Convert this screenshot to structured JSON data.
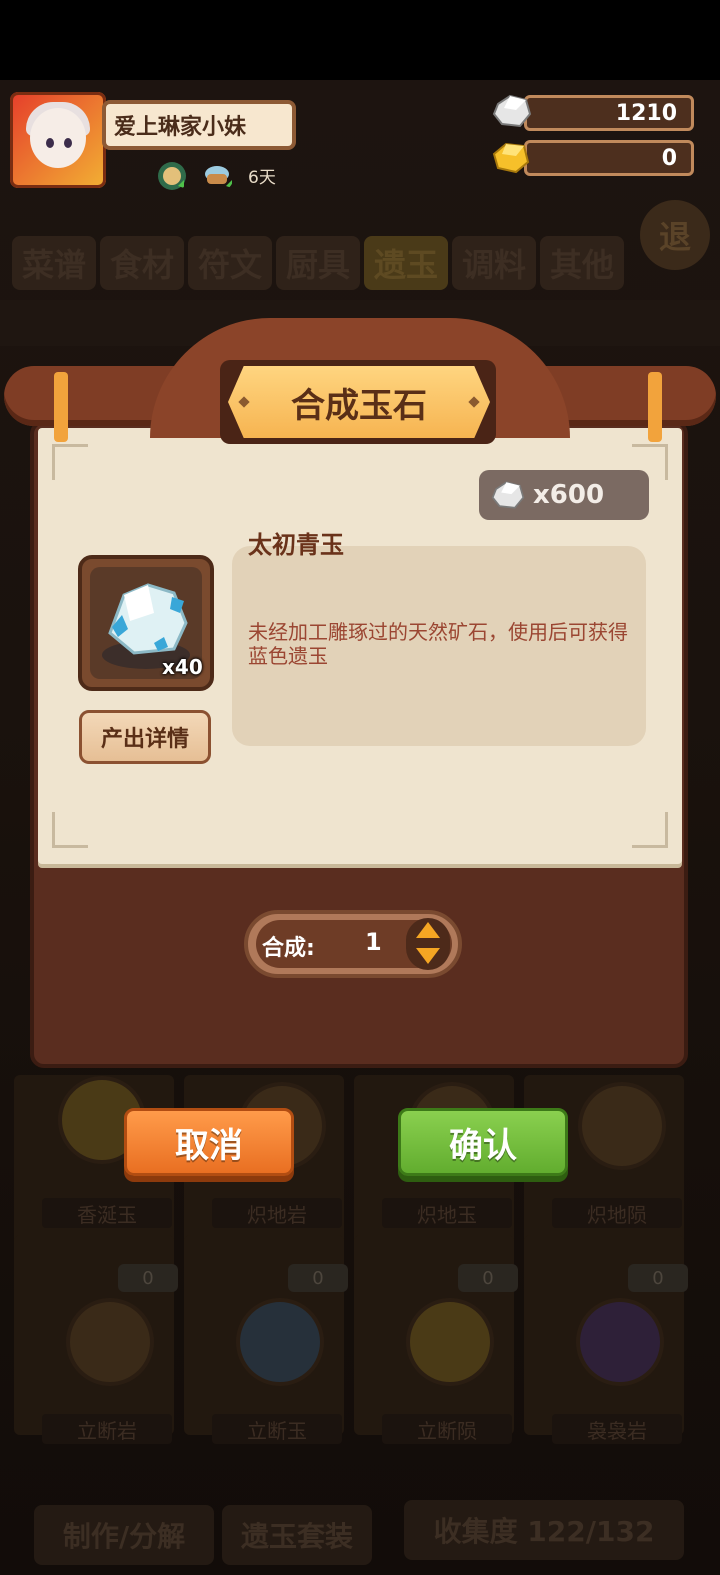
{
  "header": {
    "player_name": "爱上琳家小妹",
    "days": "6天",
    "status_icons": [
      "food-plate-icon",
      "cooking-pot-icon"
    ]
  },
  "resources": [
    {
      "icon": "silver-stone-icon",
      "value": "1210"
    },
    {
      "icon": "gold-ingot-icon",
      "value": "0"
    }
  ],
  "background": {
    "tabs": [
      "菜谱",
      "食材",
      "符文",
      "厨具",
      "遗玉",
      "调料",
      "其他"
    ],
    "active_tab": "遗玉",
    "exit_label": "退",
    "row1_labels": [
      "香涎玉",
      "炽地岩",
      "炽地玉",
      "炽地陨"
    ],
    "row2_labels": [
      "立断岩",
      "立断玉",
      "立断陨",
      "袅袅岩"
    ],
    "row2_counts": [
      "0",
      "0",
      "0",
      "0"
    ],
    "bottom_buttons": [
      "制作/分解",
      "遗玉套装",
      "收集度 122/132"
    ]
  },
  "dialog": {
    "title": "合成玉石",
    "cost": "x600",
    "cost_icon": "silver-stone-icon",
    "item_name": "太初青玉",
    "item_count": "x40",
    "item_icon": "blue-jade-ore-icon",
    "description": "未经加工雕琢过的天然矿石，使用后可获得蓝色遗玉",
    "detail_button": "产出详情",
    "quantity_label": "合成:",
    "quantity_value": "1",
    "cancel_button": "取消",
    "confirm_button": "确认"
  },
  "colors": {
    "title_plate": "#f6b451",
    "cancel": "#e96f22",
    "confirm": "#62ad2f",
    "scroll_paper": "#efe4cf",
    "panel_wood": "#5a2d1f"
  }
}
